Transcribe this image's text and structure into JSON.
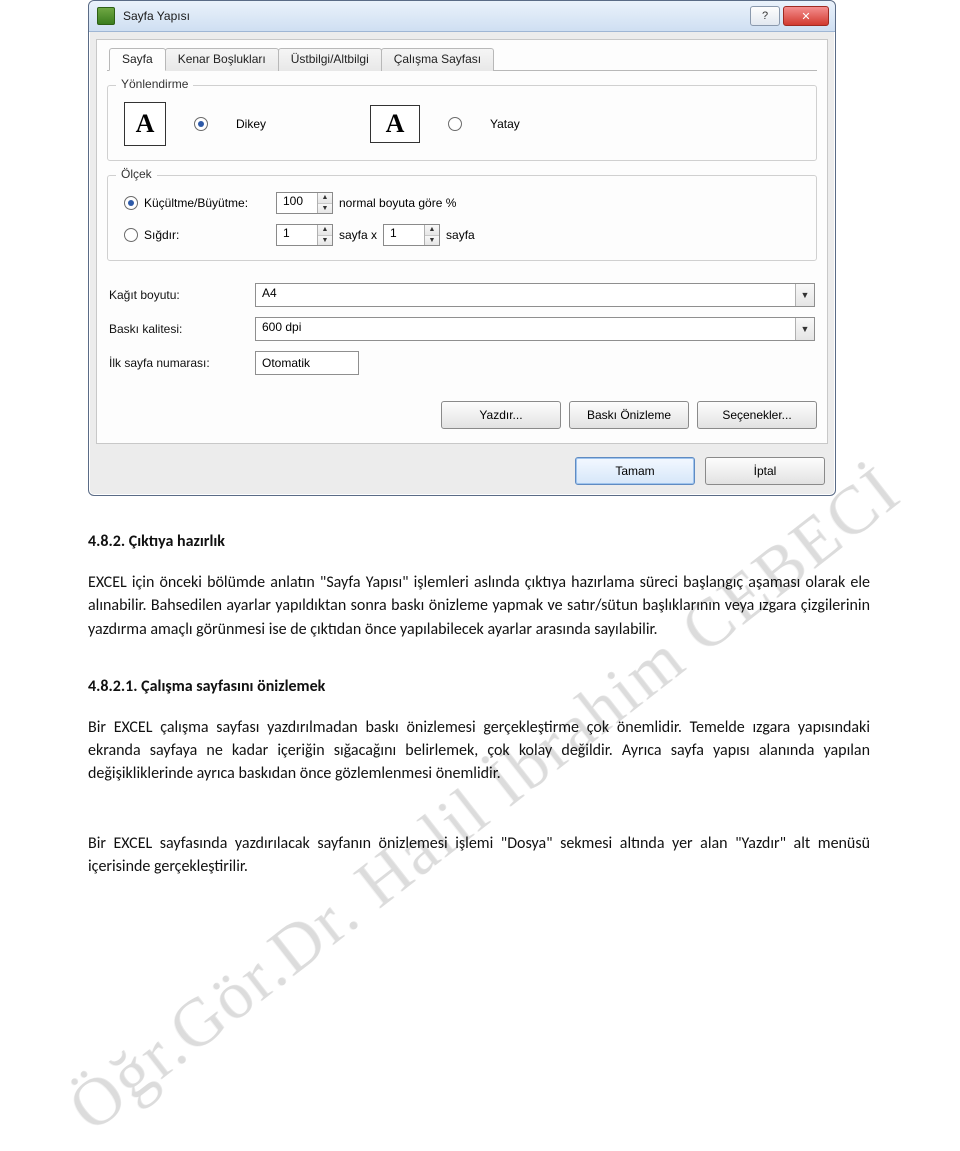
{
  "dialog": {
    "title": "Sayfa Yapısı",
    "help_glyph": "?",
    "close_glyph": "✕",
    "tabs": {
      "t0": "Sayfa",
      "t1": "Kenar Boşlukları",
      "t2": "Üstbilgi/Altbilgi",
      "t3": "Çalışma Sayfası"
    },
    "orientation": {
      "legend": "Yönlendirme",
      "portrait_icon": "A",
      "portrait_label": "Dikey",
      "landscape_icon": "A",
      "landscape_label": "Yatay"
    },
    "scale": {
      "legend": "Ölçek",
      "adjust_label": "Küçültme/Büyütme:",
      "adjust_value": "100",
      "adjust_suffix": "normal boyuta göre %",
      "fit_label": "Sığdır:",
      "fit_w": "1",
      "fit_mid": "sayfa  x",
      "fit_h": "1",
      "fit_suffix": "sayfa"
    },
    "paper": {
      "size_label": "Kağıt boyutu:",
      "size_value": "A4",
      "quality_label": "Baskı kalitesi:",
      "quality_value": "600 dpi"
    },
    "firstpage": {
      "label": "İlk sayfa numarası:",
      "value": "Otomatik"
    },
    "buttons": {
      "print": "Yazdır...",
      "preview": "Baskı Önizleme",
      "options": "Seçenekler...",
      "ok": "Tamam",
      "cancel": "İptal"
    }
  },
  "doc": {
    "h1": "4.8.2. Çıktıya hazırlık",
    "p1": "EXCEL için önceki bölümde anlatın \"Sayfa Yapısı\" işlemleri aslında çıktıya hazırlama süreci başlangıç aşaması olarak ele alınabilir. Bahsedilen ayarlar yapıldıktan sonra baskı önizleme yapmak ve satır/sütun başlıklarının veya ızgara çizgilerinin yazdırma amaçlı görünmesi ise de çıktıdan önce yapılabilecek ayarlar arasında sayılabilir.",
    "h2": "4.8.2.1. Çalışma sayfasını önizlemek",
    "p2": "Bir EXCEL çalışma sayfası yazdırılmadan baskı önizlemesi gerçekleştirme çok önemlidir. Temelde ızgara yapısındaki ekranda sayfaya ne kadar içeriğin sığacağını belirlemek, çok kolay değildir. Ayrıca sayfa yapısı alanında yapılan değişikliklerinde ayrıca baskıdan önce gözlemlenmesi önemlidir.",
    "p3": "Bir EXCEL sayfasında yazdırılacak sayfanın önizlemesi işlemi \"Dosya\" sekmesi altında yer alan \"Yazdır\" alt menüsü içerisinde gerçekleştirilir."
  },
  "watermark": "Öğr.Gör.Dr. Halil İbrahim CEBECİ"
}
